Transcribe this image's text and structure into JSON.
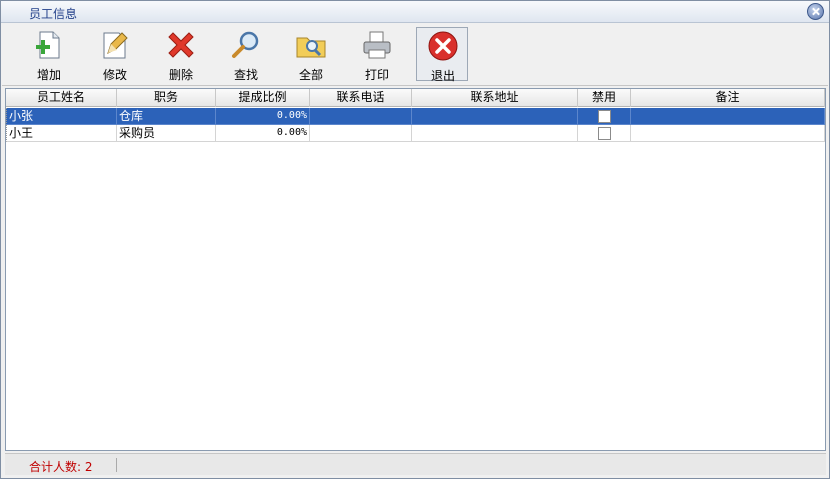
{
  "window": {
    "title": "员工信息"
  },
  "toolbar": {
    "add": "增加",
    "edit": "修改",
    "delete": "删除",
    "search": "查找",
    "all": "全部",
    "print": "打印",
    "exit": "退出"
  },
  "table": {
    "columns": [
      "员工姓名",
      "职务",
      "提成比例",
      "联系电话",
      "联系地址",
      "禁用",
      "备注"
    ],
    "rows": [
      {
        "name": "小张",
        "position": "仓库",
        "commission": "0.00%",
        "phone": "",
        "address": "",
        "disabled": false,
        "note": ""
      },
      {
        "name": "小王",
        "position": "采购员",
        "commission": "0.00%",
        "phone": "",
        "address": "",
        "disabled": false,
        "note": ""
      }
    ]
  },
  "status": {
    "total": "合计人数: 2"
  },
  "colors": {
    "selection": "#2c62b9",
    "status_text": "#c00000",
    "title_text": "#23408a"
  }
}
